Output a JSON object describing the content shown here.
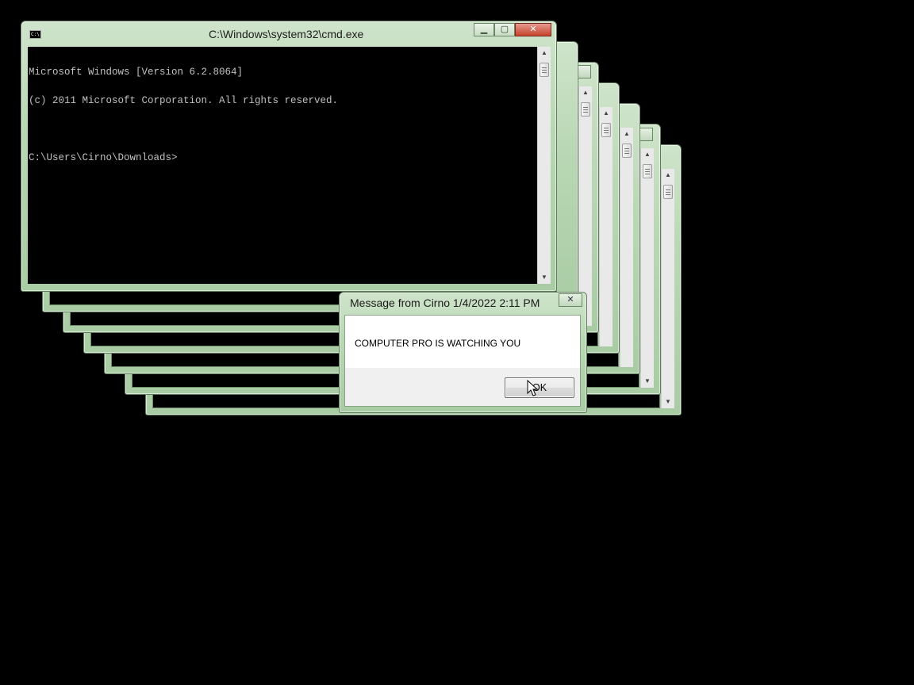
{
  "cmd_window": {
    "title": "C:\\Windows\\system32\\cmd.exe",
    "minimize_glyph": "▁",
    "maximize_glyph": "▢",
    "close_glyph": "✕",
    "console_lines": [
      "Microsoft Windows [Version 6.2.8064]",
      "(c) 2011 Microsoft Corporation. All rights reserved.",
      "",
      "C:\\Users\\Cirno\\Downloads>"
    ],
    "scroll_up": "▲",
    "scroll_down": "▼",
    "icon": "cmd-icon"
  },
  "background_windows": {
    "close_glyph": "✕",
    "minimize_glyph": "▁",
    "maximize_glyph": "▢",
    "scroll_up": "▲",
    "scroll_down": "▼"
  },
  "message_box": {
    "title": "Message from Cirno 1/4/2022 2:11 PM",
    "text": "COMPUTER PRO IS WATCHING YOU",
    "ok_label": "OK",
    "close_glyph": "✕"
  },
  "colors": {
    "frame_green": "#b9d7b4",
    "console_bg": "#000000",
    "console_text": "#c0c0c0",
    "close_red": "#c7432d"
  },
  "icons": [
    "cmd-icon",
    "minimize-icon",
    "maximize-icon",
    "close-icon",
    "mouse-cursor-icon"
  ]
}
